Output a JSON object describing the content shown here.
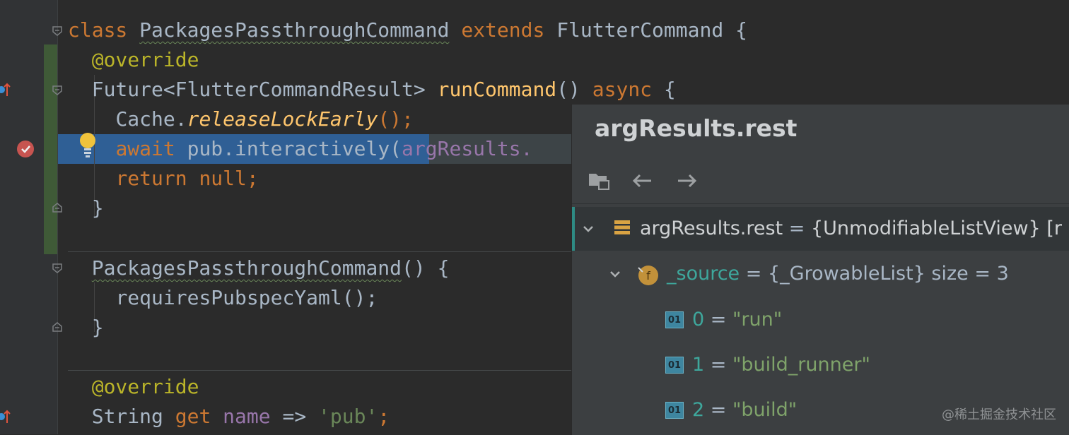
{
  "code": {
    "l1": {
      "kw1": "class",
      "name": "PackagesPassthroughCommand",
      "kw2": "extends",
      "parent": "FlutterCommand",
      "brace": "{"
    },
    "l2": {
      "ann": "@override"
    },
    "l3": {
      "type": "Future<FlutterCommandResult>",
      "fn": "runCommand",
      "parens": "()",
      "kw": "async",
      "brace": "{"
    },
    "l4": {
      "obj": "Cache.",
      "call": "releaseLockEarly",
      "tail": "();"
    },
    "l5": {
      "kw": "await",
      "call": "pub.interactively(",
      "arg": "argResults."
    },
    "l6": {
      "kw1": "return",
      "kw2": "null",
      "semi": ";"
    },
    "l7": {
      "brace": "}"
    },
    "l8": {
      "ctor": "PackagesPassthroughCommand",
      "tail": "() {"
    },
    "l9": {
      "call": "requiresPubspecYaml();"
    },
    "l10": {
      "brace": "}"
    },
    "l11": {
      "ann": "@override"
    },
    "l12": {
      "type": "String",
      "kw": "get",
      "name": "name",
      "arrow": "=>",
      "str": "'pub'",
      "semi": ";"
    }
  },
  "popup": {
    "title": "argResults.rest",
    "toolbar": {
      "open_icon": "open-in-panel-icon",
      "back_icon": "arrow-left-icon",
      "forward_icon": "arrow-right-icon"
    },
    "root": {
      "name": "argResults.rest",
      "eq": " = ",
      "value": "{UnmodifiableListView} [r"
    },
    "child": {
      "name": "_source",
      "eq": " = ",
      "value": "{_GrowableList} size = 3"
    },
    "items": [
      {
        "index": "0",
        "eq": " = ",
        "value": "\"run\""
      },
      {
        "index": "1",
        "eq": " = ",
        "value": "\"build_runner\""
      },
      {
        "index": "2",
        "eq": " = ",
        "value": "\"build\""
      }
    ],
    "index_badge": "01",
    "field_badge": "f"
  },
  "watermark": "@稀土掘金技术社区",
  "colors": {
    "accent_teal": "#3ea79c",
    "selection": "#2f5f95",
    "keyword": "#cc7832",
    "function": "#ffc66d"
  }
}
